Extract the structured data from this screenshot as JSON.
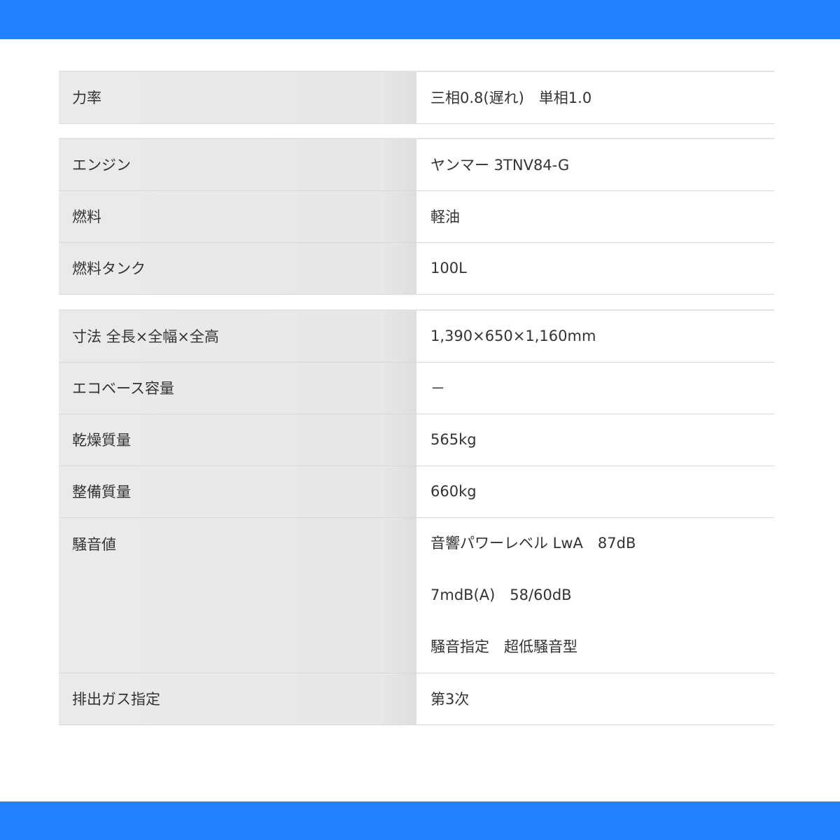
{
  "colors": {
    "accent_bar": "#2080ff"
  },
  "tables": [
    {
      "rows": [
        {
          "label": "力率",
          "value": "三相0.8(遅れ)　単相1.0"
        }
      ]
    },
    {
      "rows": [
        {
          "label": "エンジン",
          "value": "ヤンマー 3TNV84-G"
        },
        {
          "label": "燃料",
          "value": "軽油"
        },
        {
          "label": "燃料タンク",
          "value": "100L"
        }
      ]
    },
    {
      "rows": [
        {
          "label": "寸法 全長×全幅×全高",
          "value": "1,390×650×1,160mm"
        },
        {
          "label": "エコベース容量",
          "value": "－"
        },
        {
          "label": "乾燥質量",
          "value": "565kg"
        },
        {
          "label": "整備質量",
          "value": "660kg"
        },
        {
          "label": "騒音値",
          "values": [
            "音響パワーレベル LwA　87dB",
            "7mdB(A)　58/60dB",
            "騒音指定　超低騒音型"
          ]
        },
        {
          "label": "排出ガス指定",
          "value": "第3次"
        }
      ]
    }
  ]
}
